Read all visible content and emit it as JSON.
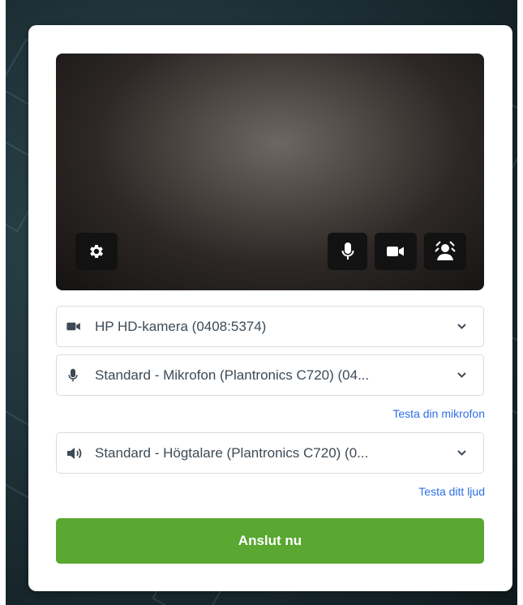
{
  "devices": {
    "camera": {
      "icon": "video-camera-icon",
      "value": "HP HD-kamera (0408:5374)"
    },
    "microphone": {
      "icon": "microphone-icon",
      "value": "Standard - Mikrofon (Plantronics C720) (04..."
    },
    "speaker": {
      "icon": "speaker-icon",
      "value": "Standard - Högtalare (Plantronics C720) (0..."
    }
  },
  "links": {
    "test_microphone": "Testa din mikrofon",
    "test_audio": "Testa ditt ljud"
  },
  "join_button": {
    "label": "Anslut nu"
  },
  "controls": {
    "settings_icon": "gear-icon",
    "mic_icon": "microphone-icon",
    "camera_icon": "video-camera-icon",
    "background_icon": "background-blur-icon"
  },
  "colors": {
    "accent_green": "#5aa731",
    "link_blue": "#2e6ee8",
    "text_gray": "#3d4a55",
    "control_bg": "#121212"
  }
}
